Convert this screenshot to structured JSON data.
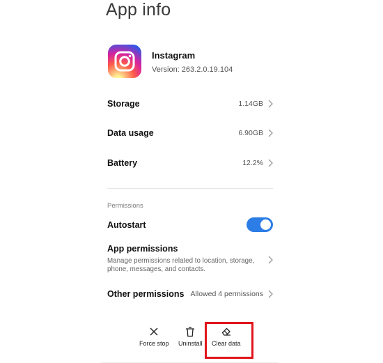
{
  "header": {
    "title": "App info"
  },
  "app": {
    "icon": "instagram-app-icon",
    "name": "Instagram",
    "version": "Version: 263.2.0.19.104"
  },
  "rows": [
    {
      "label": "Storage",
      "value": "1.14GB"
    },
    {
      "label": "Data usage",
      "value": "6.90GB"
    },
    {
      "label": "Battery",
      "value": "12.2%"
    }
  ],
  "permissions": {
    "section_label": "Permissions",
    "autostart": {
      "label": "Autostart",
      "enabled": true
    },
    "app_permissions": {
      "title": "App permissions",
      "description": "Manage permissions related to location, storage, phone, messages, and contacts."
    },
    "other_permissions": {
      "label": "Other permissions",
      "value": "Allowed 4 permissions"
    }
  },
  "actions": [
    {
      "icon": "close-icon",
      "label": "Force stop"
    },
    {
      "icon": "trash-icon",
      "label": "Uninstall"
    },
    {
      "icon": "eraser-icon",
      "label": "Clear data"
    }
  ],
  "colors": {
    "toggle_on": "#2d7de6",
    "highlight": "#e0141b"
  }
}
